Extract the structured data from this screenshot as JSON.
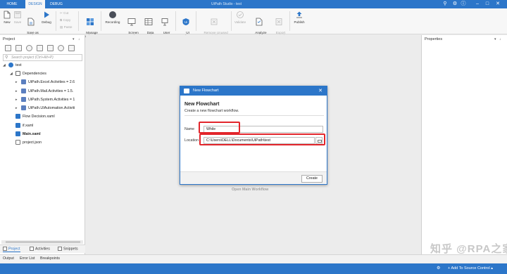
{
  "titlebar": {
    "tabs": [
      "HOME",
      "DESIGN",
      "DEBUG"
    ],
    "active_tab": "DESIGN",
    "title": "UiPath Studio - test",
    "icons": [
      "search-icon",
      "settings-icon",
      "help-icon",
      "minimize-icon",
      "maximize-icon",
      "close-icon"
    ]
  },
  "ribbon": {
    "new": "New",
    "save": "Save",
    "save_as_template": "Save as\nTemplate",
    "debug": "Debug",
    "cut": "Cut",
    "copy": "Copy",
    "paste": "Paste",
    "manage_packages": "Manage\nPackages",
    "recording": "Recording",
    "screen_scraping": "Screen\nScraping",
    "data_scraping": "Data\nScraping",
    "user_events": "User\nEvents",
    "ui_explorer": "UI\nExplorer",
    "remove_unused_variables": "Remove Unused\nVariables",
    "validate": "Validate",
    "analyze_project": "Analyze\nProject",
    "export_to_excel": "Export\nto Excel",
    "publish": "Publish"
  },
  "project_panel": {
    "title": "Project",
    "search_placeholder": "Search project (Ctrl+Alt+P)",
    "tree": {
      "root": "test",
      "dependencies": "Dependencies",
      "packages": [
        "UiPath.Excel.Activities = 2.6",
        "UiPath.Mail.Activities = 1.5.",
        "UiPath.System.Activities = 1",
        "UiPath.UIAutomation.Activiti"
      ],
      "files": [
        "Flow Decision.xaml",
        "if.xaml",
        "Main.xaml",
        "project.json"
      ]
    },
    "bottom_tabs": [
      "Project",
      "Activities",
      "Snippets"
    ]
  },
  "output_tabs": [
    "Output",
    "Error List",
    "Breakpoints"
  ],
  "canvas": {
    "hint": "Open Main Workflow"
  },
  "properties_panel": {
    "title": "Properties"
  },
  "dialog": {
    "title": "New Flowchart",
    "heading": "New Flowchart",
    "subtitle": "Create a new flowchart workflow.",
    "name_label": "Name",
    "name_value": "While",
    "location_label": "Location",
    "location_value": "C:\\Users\\DELL\\Documents\\UiPath\\test",
    "create_button": "Create",
    "highlight_color": "#e2252b"
  },
  "statusbar": {
    "source_control": "Add To Source Control",
    "accent": "#2c76c9"
  },
  "watermark": "知乎 @RPA之家"
}
